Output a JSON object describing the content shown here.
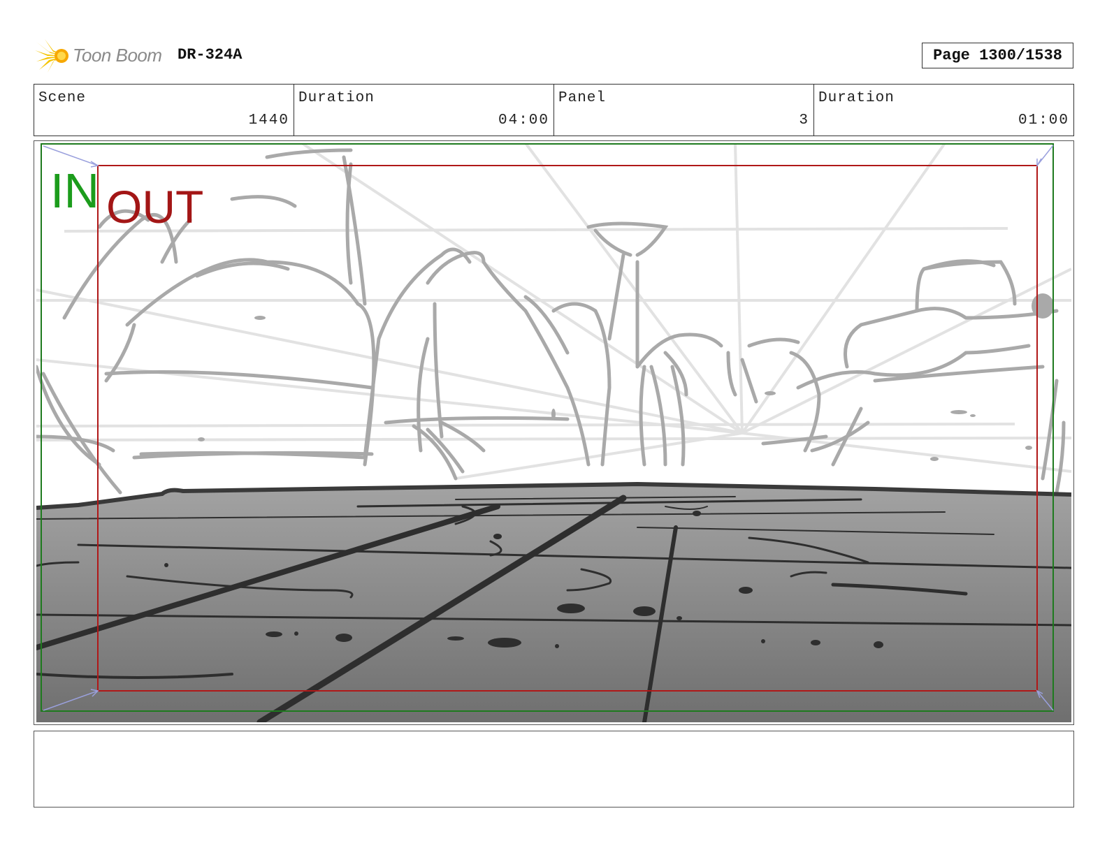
{
  "header": {
    "logo_text": "Toon Boom",
    "production_code": "DR-324A",
    "page_label": "Page 1300/1538"
  },
  "info": {
    "scene_label": "Scene",
    "scene_value": "1440",
    "scene_duration_label": "Duration",
    "scene_duration_value": "04:00",
    "panel_label": "Panel",
    "panel_value": "3",
    "panel_duration_label": "Duration",
    "panel_duration_value": "01:00"
  },
  "frame": {
    "in_label": "IN",
    "out_label": "OUT",
    "in_color": "#1c9c1c",
    "out_color": "#a31616"
  },
  "notes": {
    "text": ""
  }
}
